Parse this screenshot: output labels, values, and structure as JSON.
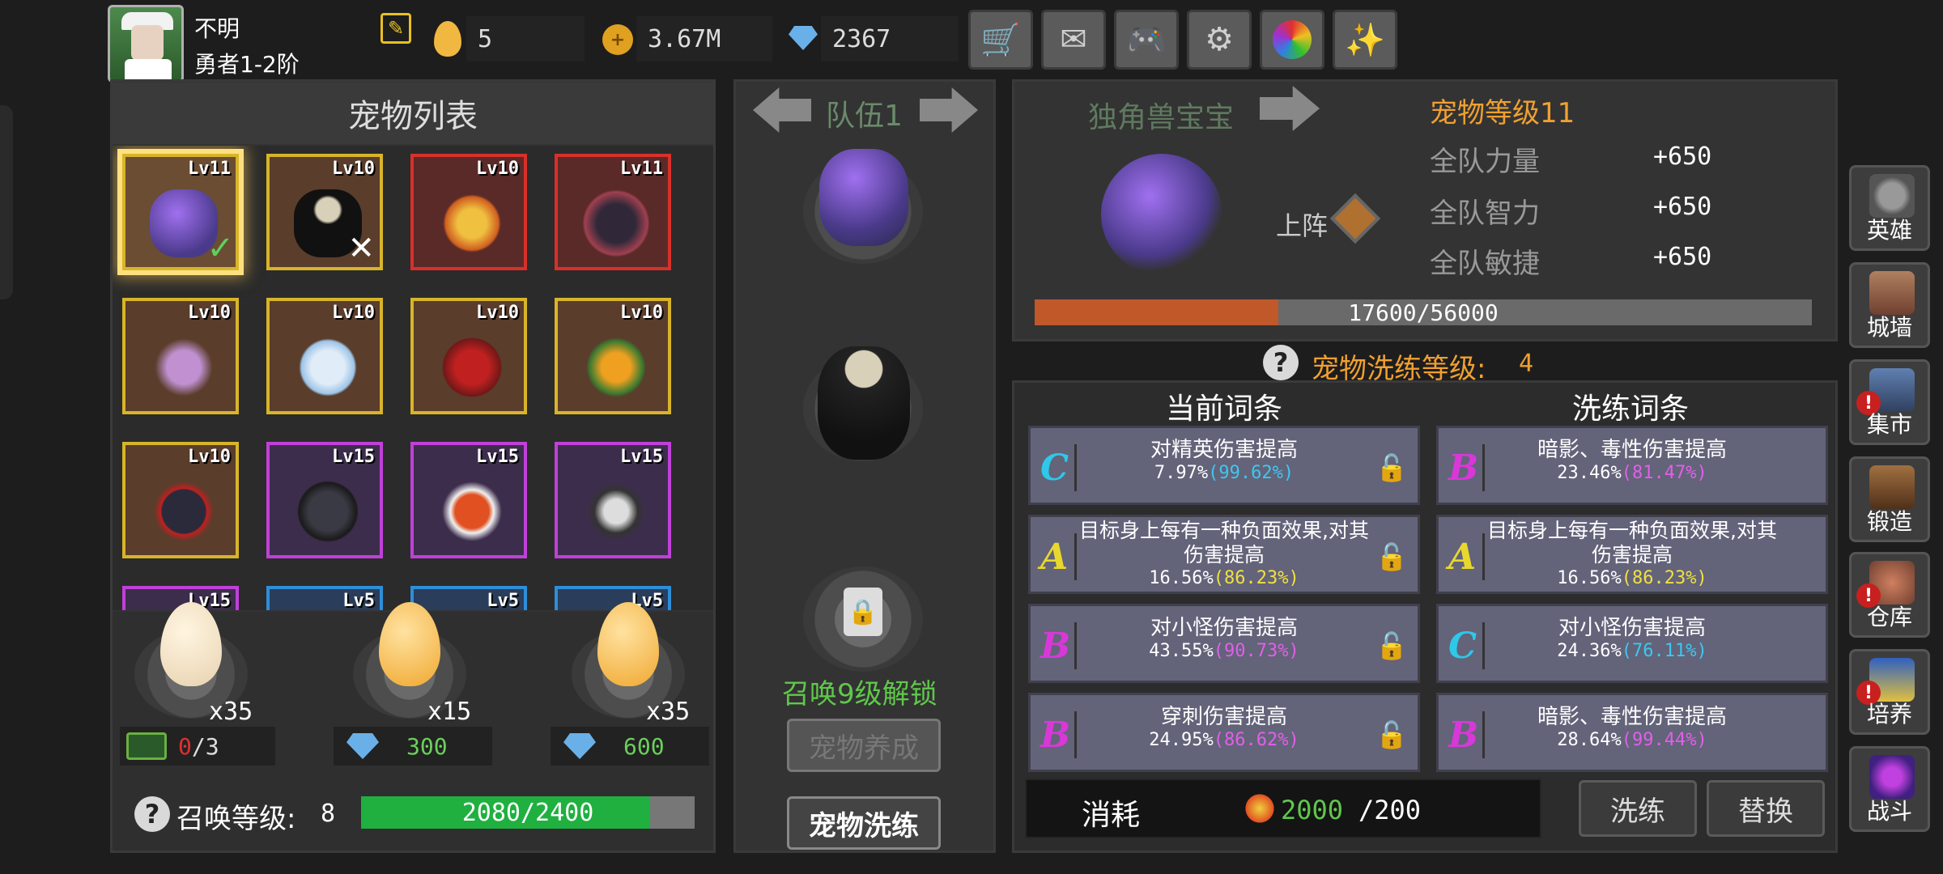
{
  "player": {
    "name": "不明",
    "rank": "勇者1-2阶"
  },
  "resources": {
    "egg_count": "5",
    "gold": "3.67M",
    "diamonds": "2367"
  },
  "top_buttons": [
    "cart-icon",
    "mail-icon",
    "gamepad-icon",
    "gear-icon",
    "color-wheel-icon",
    "firework-icon"
  ],
  "pet_list": {
    "title": "宠物列表",
    "pets": [
      {
        "level": "Lv11",
        "frame": "gold",
        "selected": true,
        "mark": "check"
      },
      {
        "level": "Lv10",
        "frame": "gold",
        "mark": "cross"
      },
      {
        "level": "Lv10",
        "frame": "red"
      },
      {
        "level": "Lv11",
        "frame": "red"
      },
      {
        "level": "Lv10",
        "frame": "gold"
      },
      {
        "level": "Lv10",
        "frame": "gold"
      },
      {
        "level": "Lv10",
        "frame": "gold"
      },
      {
        "level": "Lv10",
        "frame": "gold"
      },
      {
        "level": "Lv10",
        "frame": "gold"
      },
      {
        "level": "Lv15",
        "frame": "purple"
      },
      {
        "level": "Lv15",
        "frame": "purple"
      },
      {
        "level": "Lv15",
        "frame": "purple"
      },
      {
        "level": "Lv15",
        "frame": "purple"
      },
      {
        "level": "Lv5",
        "frame": "blue"
      },
      {
        "level": "Lv5",
        "frame": "blue"
      },
      {
        "level": "Lv5",
        "frame": "blue"
      }
    ]
  },
  "summon": {
    "eggs": [
      {
        "count": "x35",
        "cost_current": "0",
        "cost_total": "/3"
      },
      {
        "count": "x15",
        "cost": "300"
      },
      {
        "count": "x35",
        "cost": "600"
      }
    ],
    "level_label": "召唤等级:",
    "level": "8",
    "progress_text": "2080/2400",
    "progress": 0.867
  },
  "team": {
    "title": "队伍1",
    "unlock_text": "召唤9级解锁",
    "btn_raise": "宠物养成",
    "btn_refine": "宠物洗练"
  },
  "detail": {
    "pet_name": "独角兽宝宝",
    "pet_level": "宠物等级11",
    "deploy_label": "上阵",
    "stats": [
      {
        "label": "全队力量",
        "value": "+650"
      },
      {
        "label": "全队智力",
        "value": "+650"
      },
      {
        "label": "全队敏捷",
        "value": "+650"
      }
    ],
    "exp_text": "17600/56000",
    "exp": 0.314,
    "refine_level_label": "宠物洗练等级:",
    "refine_level": "4"
  },
  "affixes": {
    "current_title": "当前词条",
    "refine_title": "洗练词条",
    "current": [
      {
        "grade": "C",
        "color": "#2ec8e8",
        "text": "对精英伤害提高",
        "value": "7.97%",
        "range": "(99.62%)",
        "range_color": "#3cc8f0"
      },
      {
        "grade": "A",
        "color": "#e8d82e",
        "text": "目标身上每有一种负面效果,对其伤害提高",
        "value": "16.56%",
        "range": "(86.23%)",
        "range_color": "#f0e040"
      },
      {
        "grade": "B",
        "color": "#d838d8",
        "text": "对小怪伤害提高",
        "value": "43.55%",
        "range": "(90.73%)",
        "range_color": "#e060e8"
      },
      {
        "grade": "B",
        "color": "#d838d8",
        "text": "穿刺伤害提高",
        "value": "24.95%",
        "range": "(86.62%)",
        "range_color": "#e060e8"
      }
    ],
    "refine": [
      {
        "grade": "B",
        "color": "#d838d8",
        "text": "暗影、毒性伤害提高",
        "value": "23.46%",
        "range": "(81.47%)",
        "range_color": "#e060e8"
      },
      {
        "grade": "A",
        "color": "#e8d82e",
        "text": "目标身上每有一种负面效果,对其伤害提高",
        "value": "16.56%",
        "range": "(86.23%)",
        "range_color": "#f0e040"
      },
      {
        "grade": "C",
        "color": "#2ec8e8",
        "text": "对小怪伤害提高",
        "value": "24.36%",
        "range": "(76.11%)",
        "range_color": "#3cc8f0"
      },
      {
        "grade": "B",
        "color": "#d838d8",
        "text": "暗影、毒性伤害提高",
        "value": "28.64%",
        "range": "(99.44%)",
        "range_color": "#e060e8"
      }
    ]
  },
  "cost": {
    "label": "消耗",
    "have": "2000",
    "need": "/200"
  },
  "actions": {
    "refine": "洗练",
    "replace": "替换"
  },
  "sidebar": [
    {
      "label": "英雄",
      "alert": false
    },
    {
      "label": "城墙",
      "alert": false
    },
    {
      "label": "集市",
      "alert": true
    },
    {
      "label": "锻造",
      "alert": false
    },
    {
      "label": "仓库",
      "alert": true
    },
    {
      "label": "培养",
      "alert": true
    },
    {
      "label": "战斗",
      "alert": false
    }
  ],
  "colors": {
    "accent_orange": "#f0a030",
    "green_text": "#5fc84a",
    "progress_green": "#1fb040",
    "exp_orange": "#c0582a"
  }
}
